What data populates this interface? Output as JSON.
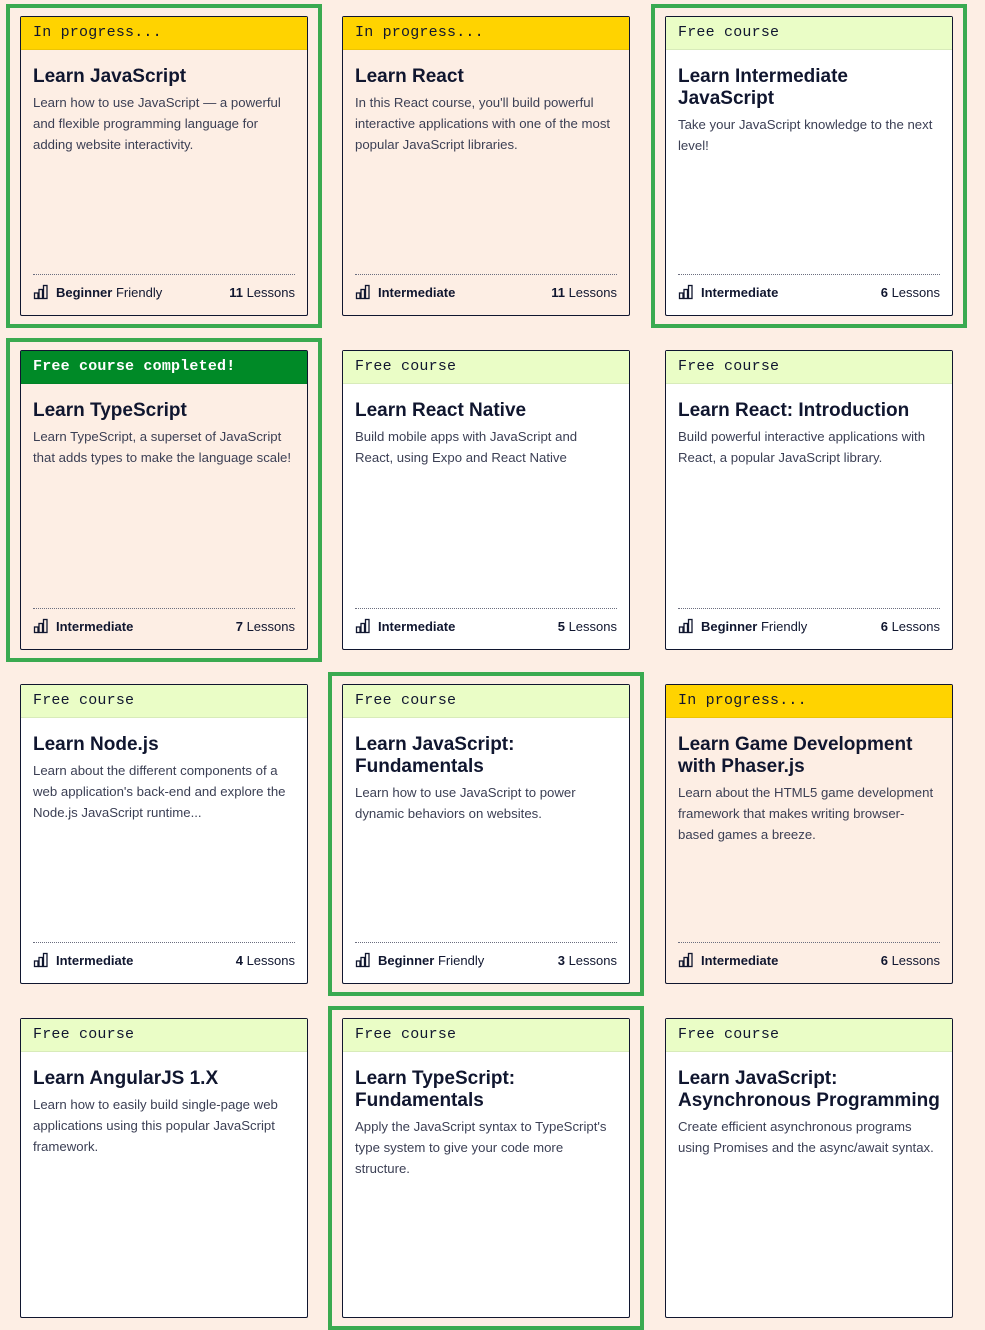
{
  "colors": {
    "page_bg": "#fdeee4",
    "free_label_bg": "#eafdc6",
    "progress_label_bg": "#ffd300",
    "completed_label_bg": "#008a27",
    "highlight": "#3aaa50"
  },
  "courses": [
    {
      "label": "In progress...",
      "label_type": "progress",
      "title": "Learn JavaScript",
      "description": "Learn how to use JavaScript — a powerful and flexible programming language for adding website interactivity.",
      "level": "Beginner",
      "level_suffix": "Friendly",
      "lesson_count": "11",
      "lessons_word": "Lessons",
      "highlighted": true,
      "icon": "bar-chart-icon"
    },
    {
      "label": "In progress...",
      "label_type": "progress",
      "title": "Learn React",
      "description": "In this React course, you'll build powerful interactive applications with one of the most popular JavaScript libraries.",
      "level": "Intermediate",
      "level_suffix": "",
      "lesson_count": "11",
      "lessons_word": "Lessons",
      "highlighted": false,
      "icon": "bar-chart-icon"
    },
    {
      "label": "Free course",
      "label_type": "free",
      "title": "Learn Intermediate JavaScript",
      "description": "Take your JavaScript knowledge to the next level!",
      "level": "Intermediate",
      "level_suffix": "",
      "lesson_count": "6",
      "lessons_word": "Lessons",
      "highlighted": true,
      "icon": "bar-chart-icon"
    },
    {
      "label": "Free course completed!",
      "label_type": "completed",
      "title": "Learn TypeScript",
      "description": "Learn TypeScript, a superset of JavaScript that adds types to make the language scale!",
      "level": "Intermediate",
      "level_suffix": "",
      "lesson_count": "7",
      "lessons_word": "Lessons",
      "highlighted": true,
      "icon": "bar-chart-icon"
    },
    {
      "label": "Free course",
      "label_type": "free",
      "title": "Learn React Native",
      "description": "Build mobile apps with JavaScript and React, using Expo and React Native",
      "level": "Intermediate",
      "level_suffix": "",
      "lesson_count": "5",
      "lessons_word": "Lessons",
      "highlighted": false,
      "icon": "bar-chart-icon"
    },
    {
      "label": "Free course",
      "label_type": "free",
      "title": "Learn React: Introduction",
      "description": "Build powerful interactive applications with React, a popular JavaScript library.",
      "level": "Beginner",
      "level_suffix": "Friendly",
      "lesson_count": "6",
      "lessons_word": "Lessons",
      "highlighted": false,
      "icon": "bar-chart-icon"
    },
    {
      "label": "Free course",
      "label_type": "free",
      "title": "Learn Node.js",
      "description": "Learn about the different components of a web application's back-end and explore the Node.js JavaScript runtime...",
      "level": "Intermediate",
      "level_suffix": "",
      "lesson_count": "4",
      "lessons_word": "Lessons",
      "highlighted": false,
      "icon": "bar-chart-icon"
    },
    {
      "label": "Free course",
      "label_type": "free",
      "title": "Learn JavaScript: Fundamentals",
      "description": "Learn how to use JavaScript to power dynamic behaviors on websites.",
      "level": "Beginner",
      "level_suffix": "Friendly",
      "lesson_count": "3",
      "lessons_word": "Lessons",
      "highlighted": true,
      "icon": "bar-chart-icon"
    },
    {
      "label": "In progress...",
      "label_type": "progress",
      "title": "Learn Game Development with Phaser.js",
      "description": "Learn about the HTML5 game development framework that makes writing browser-based games a breeze.",
      "level": "Intermediate",
      "level_suffix": "",
      "lesson_count": "6",
      "lessons_word": "Lessons",
      "highlighted": false,
      "icon": "bar-chart-icon"
    },
    {
      "label": "Free course",
      "label_type": "free",
      "title": "Learn AngularJS 1.X",
      "description": "Learn how to easily build single-page web applications using this popular JavaScript framework.",
      "level": "",
      "level_suffix": "",
      "lesson_count": "",
      "lessons_word": "",
      "highlighted": false,
      "icon": "bar-chart-icon"
    },
    {
      "label": "Free course",
      "label_type": "free",
      "title": "Learn TypeScript: Fundamentals",
      "description": "Apply the JavaScript syntax to TypeScript's type system to give your code more structure.",
      "level": "",
      "level_suffix": "",
      "lesson_count": "",
      "lessons_word": "",
      "highlighted": true,
      "icon": "bar-chart-icon"
    },
    {
      "label": "Free course",
      "label_type": "free",
      "title": "Learn JavaScript: Asynchronous Programming",
      "description": "Create efficient asynchronous programs using Promises and the async/await syntax.",
      "level": "",
      "level_suffix": "",
      "lesson_count": "",
      "lessons_word": "",
      "highlighted": false,
      "icon": "bar-chart-icon"
    }
  ]
}
